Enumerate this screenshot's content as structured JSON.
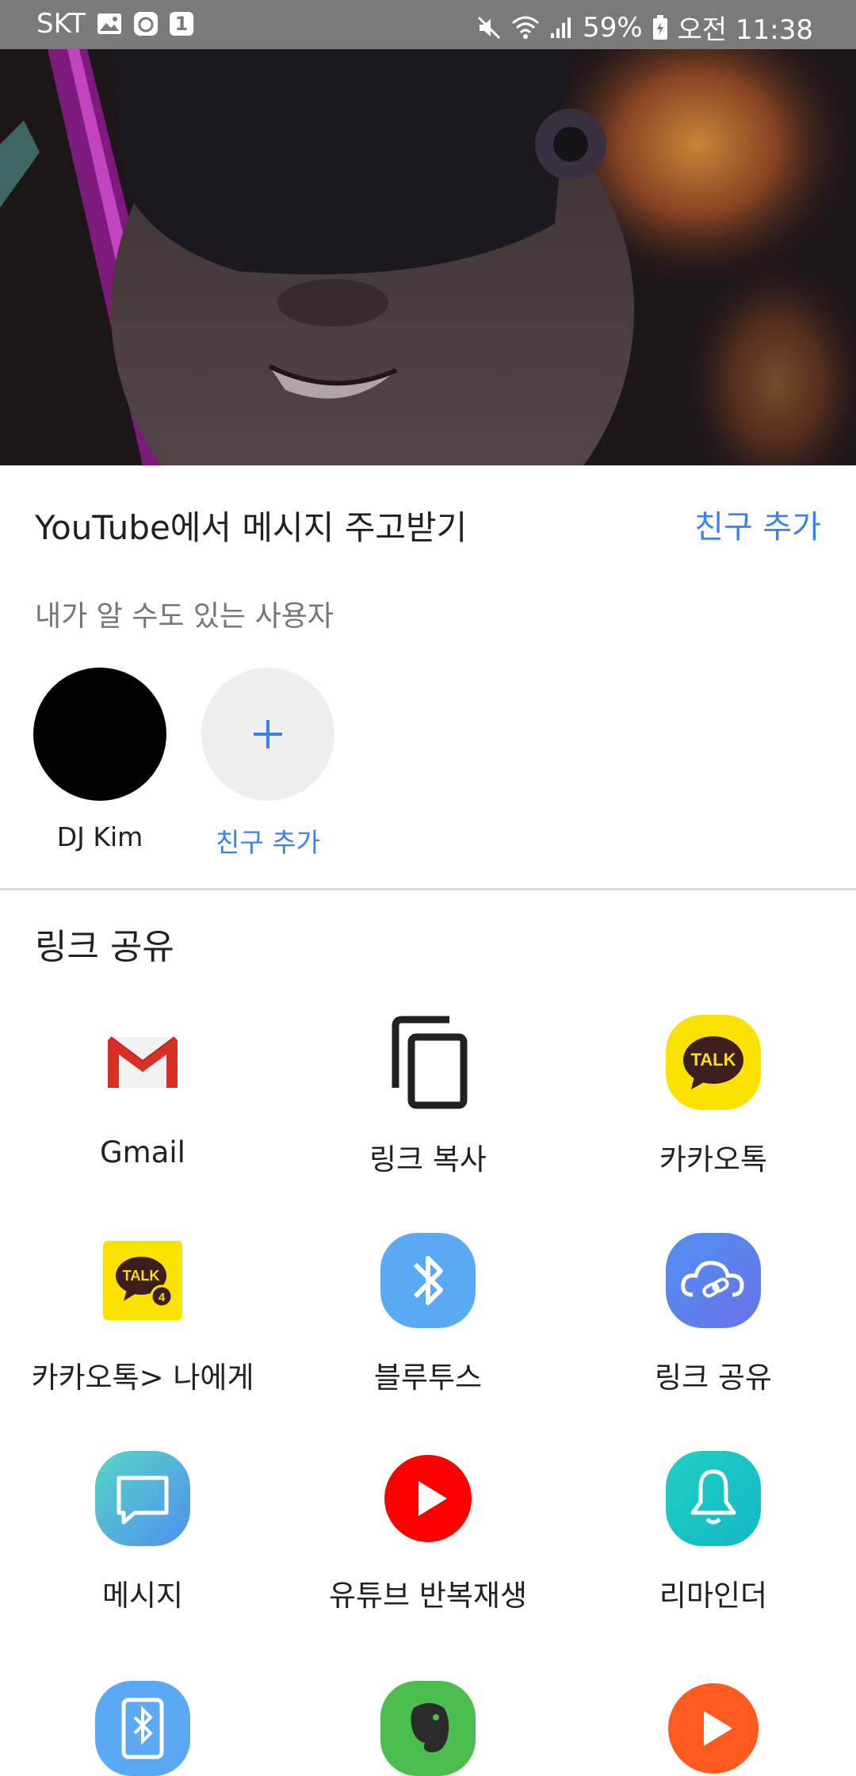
{
  "status_bar": {
    "carrier": "SKT",
    "notif_badge": "1",
    "battery": "59%",
    "time": "오전 11:38"
  },
  "sheet": {
    "title": "YouTube에서 메시지 주고받기",
    "add_friend_link": "친구 추가",
    "suggest_label": "내가 알 수도 있는 사용자",
    "contacts": [
      {
        "name": "DJ Kim"
      }
    ],
    "add_friend_button_label": "친구 추가"
  },
  "share": {
    "section_title": "링크 공유",
    "apps": [
      {
        "label": "Gmail",
        "icon": "gmail-icon"
      },
      {
        "label": "링크 복사",
        "icon": "copy-link-icon"
      },
      {
        "label": "카카오톡",
        "icon": "kakaotalk-icon"
      },
      {
        "label": "카카오톡> 나에게",
        "icon": "kakaotalk-me-icon"
      },
      {
        "label": "블루투스",
        "icon": "bluetooth-icon"
      },
      {
        "label": "링크 공유",
        "icon": "link-share-cloud-icon"
      },
      {
        "label": "메시지",
        "icon": "messages-icon"
      },
      {
        "label": "유튜브 반복재생",
        "icon": "youtube-repeat-icon"
      },
      {
        "label": "리마인더",
        "icon": "reminder-icon"
      },
      {
        "label": "",
        "icon": "bluetooth-file-icon"
      },
      {
        "label": "",
        "icon": "evernote-icon"
      },
      {
        "label": "",
        "icon": "play-orange-icon"
      }
    ]
  },
  "colors": {
    "accent": "#3b82e8",
    "status_bar": "#7a7a7a",
    "kakao_yellow": "#fae100",
    "youtube_red": "#ff0000"
  }
}
